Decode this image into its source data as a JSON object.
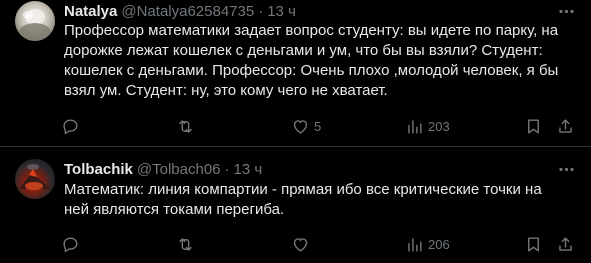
{
  "tweets": [
    {
      "name": "Natalya",
      "handle": "@Natalya62584735",
      "separator": "·",
      "time": "13 ч",
      "text": "Профессор математики задает вопрос студенту: вы идете по парку, на дорожке лежат кошелек с деньгами и ум, что бы вы взяли? Студент: кошелек с деньгами. Профессор: Очень плохо ,молодой человек, я бы взял ум. Студент: ну, это кому чего не хватает.",
      "reply_count": "",
      "retweet_count": "",
      "like_count": "5",
      "view_count": "203"
    },
    {
      "name": "Tolbachik",
      "handle": "@Tolbach06",
      "separator": "·",
      "time": "13 ч",
      "text": "Математик: линия компартии - прямая ибо все критические точки на ней являются токами перегиба.",
      "reply_count": "",
      "retweet_count": "",
      "like_count": "",
      "view_count": "206"
    }
  ],
  "icons": {
    "more": "more-dots-icon",
    "reply": "reply-icon",
    "retweet": "retweet-icon",
    "like": "heart-icon",
    "views": "views-chart-icon",
    "bookmark": "bookmark-icon",
    "share": "share-icon"
  },
  "colors": {
    "background": "#000000",
    "text": "#e7e9ea",
    "muted": "#71767b",
    "divider": "#2f3336"
  }
}
